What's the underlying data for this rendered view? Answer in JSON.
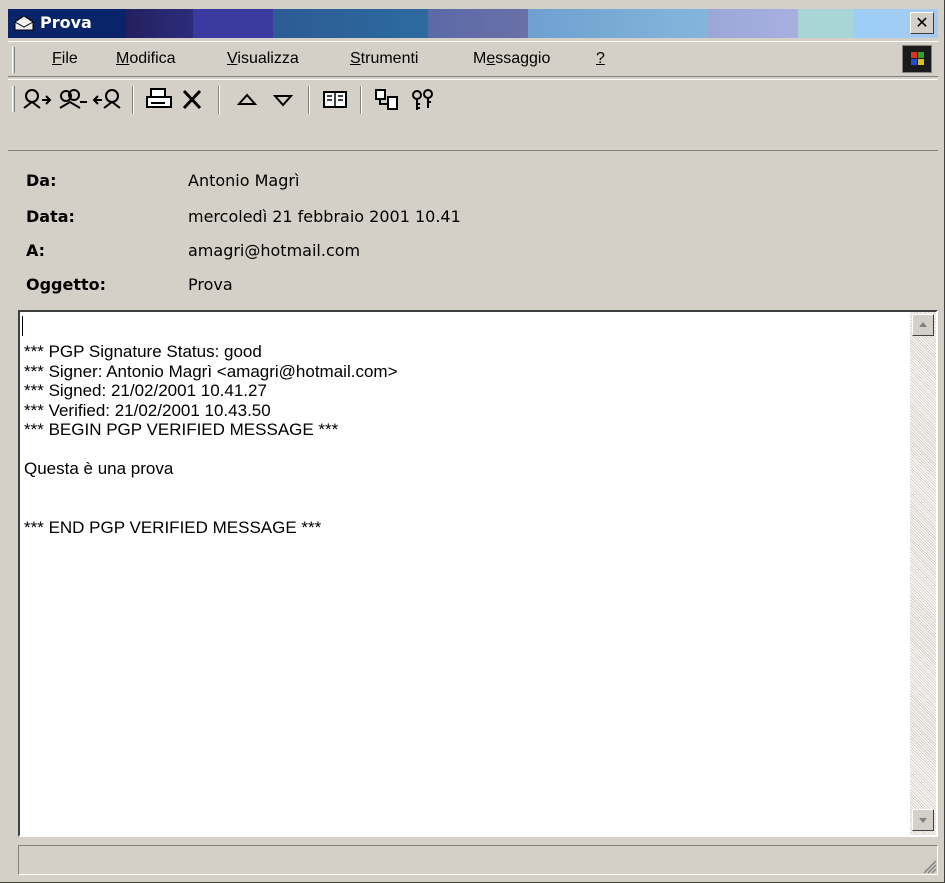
{
  "window": {
    "title": "Prova"
  },
  "menu": {
    "items": [
      {
        "label": "File"
      },
      {
        "label": "Modifica"
      },
      {
        "label": "Visualizza"
      },
      {
        "label": "Strumenti"
      },
      {
        "label": "Messaggio"
      },
      {
        "label": "?"
      }
    ]
  },
  "toolbar": {
    "buttons": [
      {
        "icon": "reply-icon"
      },
      {
        "icon": "reply-all-icon"
      },
      {
        "icon": "forward-icon"
      },
      {
        "icon": "print-icon"
      },
      {
        "icon": "delete-icon"
      },
      {
        "icon": "previous-icon"
      },
      {
        "icon": "next-icon"
      },
      {
        "icon": "address-book-icon"
      },
      {
        "icon": "encoding-icon"
      },
      {
        "icon": "pgp-keys-icon"
      }
    ]
  },
  "header": {
    "from_label": "Da:",
    "from_value": "Antonio Magrì",
    "date_label": "Data:",
    "date_value": "mercoledì 21 febbraio 2001 10.41",
    "to_label": "A:",
    "to_value": "amagri@hotmail.com",
    "subject_label": "Oggetto:",
    "subject_value": "Prova"
  },
  "message": {
    "lines": [
      "*** PGP Signature Status: good",
      "*** Signer: Antonio Magrì <amagri@hotmail.com>",
      "*** Signed: 21/02/2001 10.41.27",
      "*** Verified: 21/02/2001 10.43.50",
      "*** BEGIN PGP VERIFIED MESSAGE ***",
      "",
      "Questa è una prova",
      "",
      "",
      "*** END PGP VERIFIED MESSAGE ***"
    ]
  },
  "status": {
    "text": ""
  },
  "colors": {
    "window_face": "#d4d0c8",
    "title_text": "#ffffff"
  }
}
